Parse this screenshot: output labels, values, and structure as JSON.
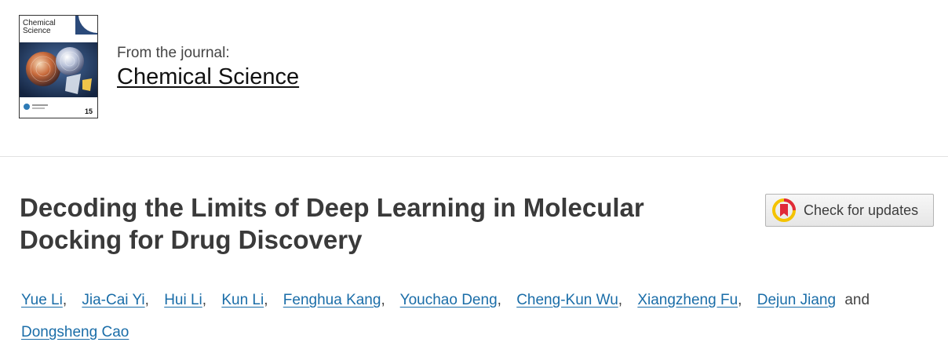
{
  "journal": {
    "cover_title_line1": "Chemical",
    "cover_title_line2": "Science",
    "cover_issue_number": "15",
    "from_label": "From the journal:",
    "name": "Chemical Science"
  },
  "article": {
    "title": "Decoding the Limits of Deep Learning in Molecular Docking for Drug Discovery",
    "check_updates_label": "Check for updates",
    "authors": [
      "Yue Li",
      "Jia-Cai Yi",
      "Hui Li",
      "Kun Li",
      "Fenghua Kang",
      "Youchao Deng",
      "Cheng-Kun Wu",
      "Xiangzheng Fu",
      "Dejun Jiang",
      "Dongsheng Cao"
    ],
    "author_separator": ",",
    "and_word": "and"
  },
  "colors": {
    "link": "#1a6da8",
    "title": "#3a3a3a",
    "check_icon_red": "#e02a39",
    "check_icon_yellow": "#f4c300"
  },
  "icons": {
    "check_updates": "bookmark-in-circle-icon"
  }
}
